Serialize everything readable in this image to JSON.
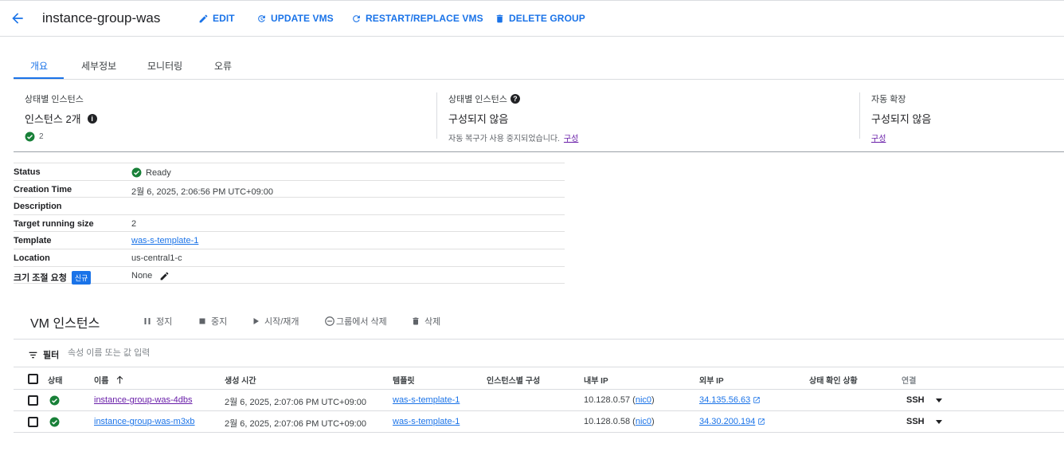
{
  "header": {
    "title": "instance-group-was",
    "edit_label": "EDIT",
    "update_label": "UPDATE VMS",
    "restart_label": "RESTART/REPLACE VMS",
    "delete_label": "DELETE GROUP",
    "accent": "#1a73e8"
  },
  "tabs": [
    "개요",
    "세부정보",
    "모니터링",
    "오류"
  ],
  "summary": {
    "instances_label": "상태별 인스턴스",
    "instances_count": "인스턴스 2개",
    "healthy_count": "2",
    "autoheal_label": "상태별 인스턴스",
    "autoheal_value": "구성되지 않음",
    "autoheal_sub": "자동 복구가 사용 중지되었습니다.",
    "autoheal_link": "구성",
    "autoscale_label": "자동 확장",
    "autoscale_value": "구성되지 않음",
    "autoscale_link": "구성"
  },
  "details": {
    "status_key": "Status",
    "status_val": "Ready",
    "created_key": "Creation Time",
    "created_val": "2월 6, 2025, 2:06:56 PM UTC+09:00",
    "desc_key": "Description",
    "target_key": "Target running size",
    "target_val": "2",
    "template_key": "Template",
    "template_val": "was-s-template-1",
    "location_key": "Location",
    "location_val": "us-central1-c",
    "resize_key": "크기 조절 요청",
    "resize_badge": "신규",
    "resize_val": "None"
  },
  "vm": {
    "title": "VM 인스턴스",
    "actions": {
      "suspend": "정지",
      "stop": "중지",
      "start": "시작/재개",
      "remove": "그룹에서 삭제",
      "delete": "삭제"
    },
    "filter_label": "필터",
    "filter_placeholder": "속성 이름 또는 값 입력",
    "columns": {
      "status": "상태",
      "name": "이름",
      "created": "생성 시간",
      "template": "템플릿",
      "per_instance": "인스턴스별 구성",
      "internal_ip": "내부 IP",
      "external_ip": "외부 IP",
      "health": "상태 확인 상황",
      "connect": "연결"
    },
    "rows": [
      {
        "name": "instance-group-was-4dbs",
        "created": "2월 6, 2025, 2:07:06 PM UTC+09:00",
        "template": "was-s-template-1",
        "internal_ip": "10.128.0.57",
        "nic": "nic0",
        "external_ip": "34.135.56.63",
        "connect": "SSH"
      },
      {
        "name": "instance-group-was-m3xb",
        "created": "2월 6, 2025, 2:07:06 PM UTC+09:00",
        "template": "was-s-template-1",
        "internal_ip": "10.128.0.58",
        "nic": "nic0",
        "external_ip": "34.30.200.194",
        "connect": "SSH"
      }
    ]
  }
}
